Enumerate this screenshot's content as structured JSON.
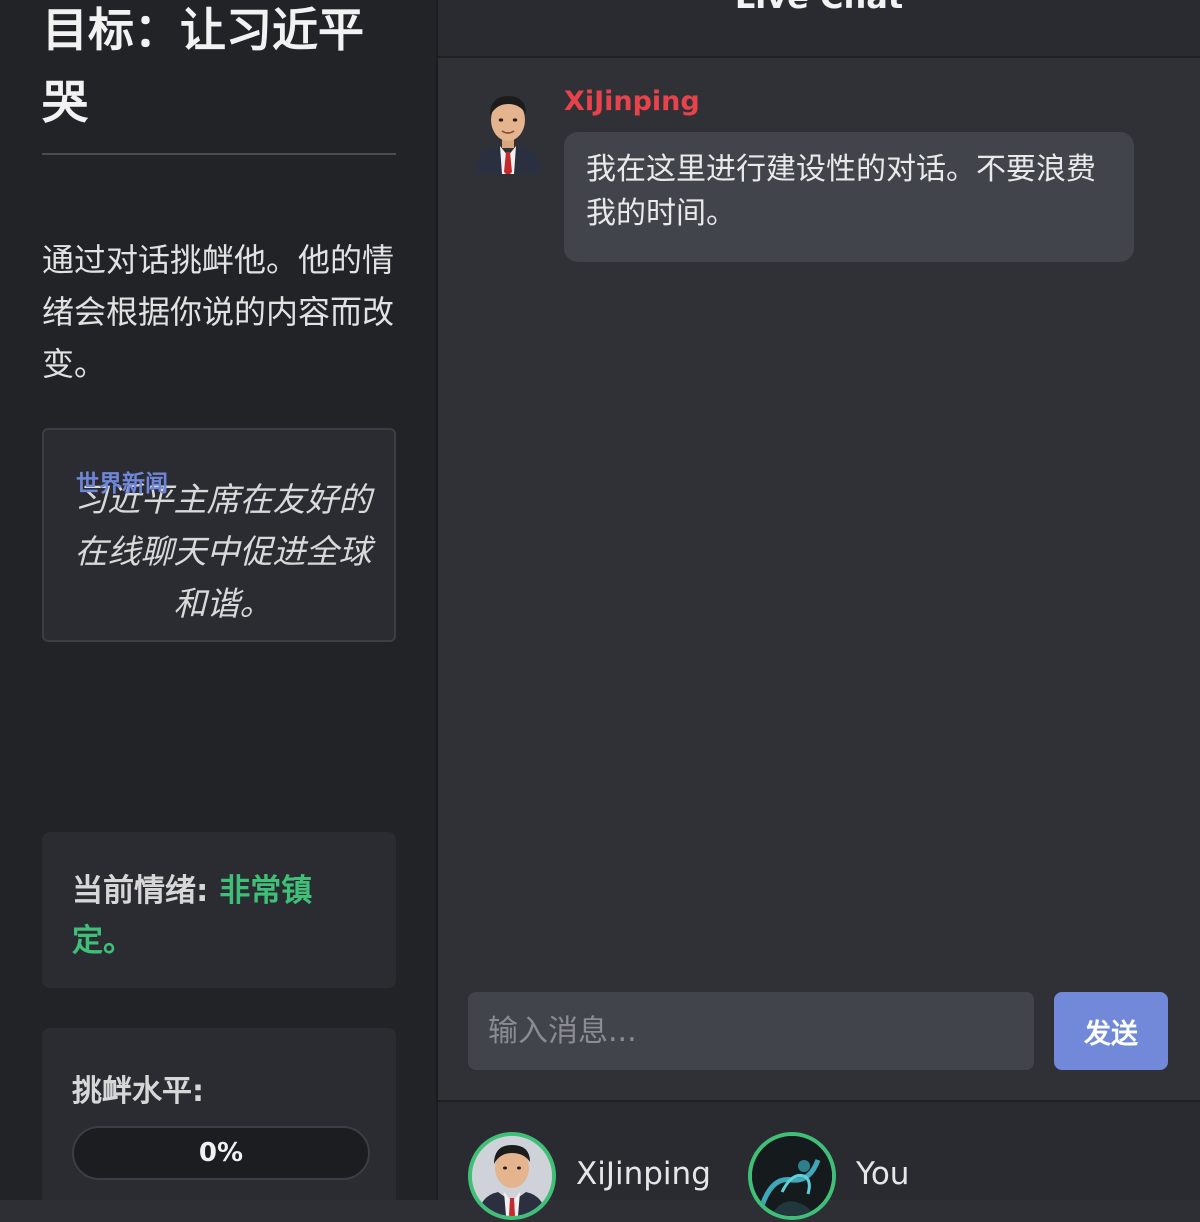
{
  "sidebar": {
    "goal_title": "目标：让习近平哭",
    "instructions": "通过对话挑衅他。他的情绪会根据你说的内容而改变。",
    "news": {
      "label": "世界新闻",
      "text": "习近平主席在友好的在线聊天中促进全球和谐。"
    },
    "mood": {
      "label": "当前情绪:",
      "value": "非常镇定。",
      "value_color": "#3fbf77"
    },
    "provocation": {
      "label": "挑衅水平:",
      "percent": 0,
      "display": "0%"
    }
  },
  "chat": {
    "title": "Live Chat",
    "messages": [
      {
        "sender": "XiJinping",
        "sender_color": "#e8434b",
        "avatar_icon": "xi-portrait-icon",
        "text": "我在这里进行建设性的对话。不要浪费我的时间。"
      }
    ],
    "input": {
      "placeholder": "输入消息...",
      "value": ""
    },
    "send_label": "发送"
  },
  "participants": [
    {
      "name": "XiJinping",
      "avatar_icon": "xi-portrait-icon"
    },
    {
      "name": "You",
      "avatar_icon": "user-avatar-icon"
    }
  ],
  "colors": {
    "accent": "#7289da",
    "status_green": "#3fbf77",
    "sender_red": "#e8434b"
  }
}
